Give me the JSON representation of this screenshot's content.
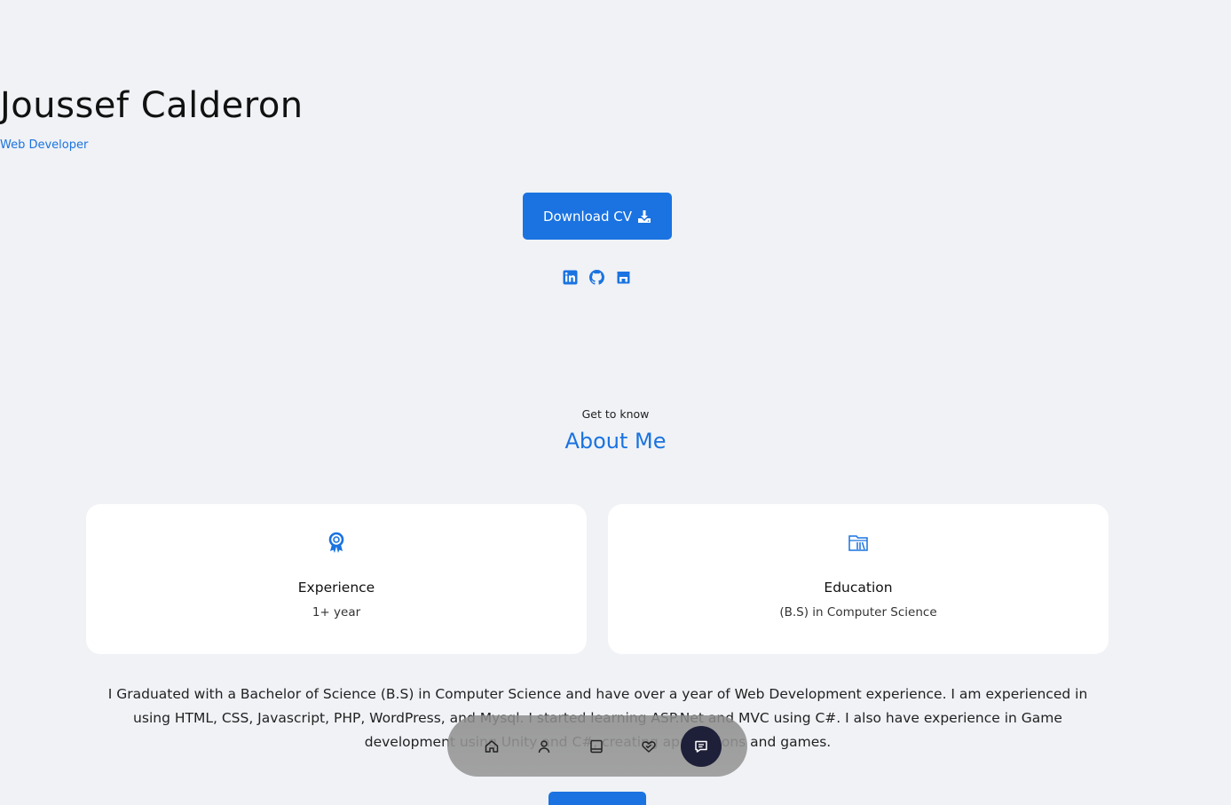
{
  "hero": {
    "name": "Joussef Calderon",
    "role": "Web Developer",
    "download_label": "Download CV",
    "socials": [
      {
        "icon": "linkedin-icon"
      },
      {
        "icon": "github-icon"
      },
      {
        "icon": "store-icon"
      }
    ]
  },
  "about": {
    "kicker": "Get to know",
    "title": "About Me",
    "cards": [
      {
        "icon": "award-icon",
        "title": "Experience",
        "subtitle": "1+ year"
      },
      {
        "icon": "library-icon",
        "title": "Education",
        "subtitle": "(B.S) in Computer Science"
      }
    ],
    "bio": "I Graduated with a Bachelor of Science (B.S) in Computer Science and have over a year of Web Development experience. I am experienced in using HTML, CSS, Javascript, PHP, WordPress, and Mysql. I started learning ASP.Net and MVC using C#. I also have experience in Game development using Unity and C#, creating applications and games."
  },
  "dock": {
    "items": [
      {
        "icon": "home-icon"
      },
      {
        "icon": "user-icon"
      },
      {
        "icon": "book-icon"
      },
      {
        "icon": "handshake-icon"
      },
      {
        "icon": "message-icon",
        "active": true
      }
    ]
  },
  "colors": {
    "accent": "#1a73e0",
    "background": "#f0f2f6",
    "dock_active": "#1e1f38"
  }
}
